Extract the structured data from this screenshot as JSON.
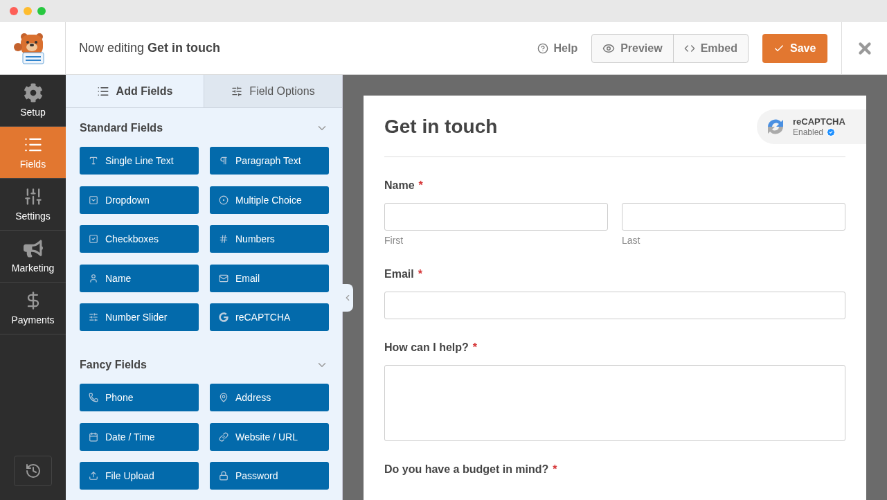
{
  "header": {
    "prefix": "Now editing",
    "form_name": "Get in touch",
    "help": "Help",
    "preview": "Preview",
    "embed": "Embed",
    "save": "Save"
  },
  "nav": [
    {
      "kind": "setup",
      "label": "Setup",
      "selected": false
    },
    {
      "kind": "fields",
      "label": "Fields",
      "selected": true
    },
    {
      "kind": "settings",
      "label": "Settings",
      "selected": false
    },
    {
      "kind": "marketing",
      "label": "Marketing",
      "selected": false
    },
    {
      "kind": "payments",
      "label": "Payments",
      "selected": false
    }
  ],
  "panel_tabs": [
    {
      "kind": "add",
      "label": "Add Fields",
      "selected": true
    },
    {
      "kind": "options",
      "label": "Field Options",
      "selected": false
    }
  ],
  "sections": [
    {
      "title": "Standard Fields",
      "expanded": true,
      "fields": [
        {
          "kind": "text",
          "label": "Single Line Text"
        },
        {
          "kind": "paragraph",
          "label": "Paragraph Text"
        },
        {
          "kind": "dropdown",
          "label": "Dropdown"
        },
        {
          "kind": "radio",
          "label": "Multiple Choice"
        },
        {
          "kind": "checkbox",
          "label": "Checkboxes"
        },
        {
          "kind": "number",
          "label": "Numbers"
        },
        {
          "kind": "name",
          "label": "Name"
        },
        {
          "kind": "email",
          "label": "Email"
        },
        {
          "kind": "slider",
          "label": "Number Slider"
        },
        {
          "kind": "captcha",
          "label": "reCAPTCHA"
        }
      ]
    },
    {
      "title": "Fancy Fields",
      "expanded": true,
      "fields": [
        {
          "kind": "phone",
          "label": "Phone"
        },
        {
          "kind": "address",
          "label": "Address"
        },
        {
          "kind": "date",
          "label": "Date / Time"
        },
        {
          "kind": "url",
          "label": "Website / URL"
        },
        {
          "kind": "upload",
          "label": "File Upload"
        },
        {
          "kind": "password",
          "label": "Password"
        }
      ]
    }
  ],
  "form": {
    "title": "Get in touch",
    "required_marker": "*",
    "recaptcha": {
      "name": "reCAPTCHA",
      "status": "Enabled"
    },
    "fields": [
      {
        "kind": "name",
        "label": "Name",
        "required": true,
        "sublabels": [
          "First",
          "Last"
        ]
      },
      {
        "kind": "email",
        "label": "Email",
        "required": true
      },
      {
        "kind": "textarea",
        "label": "How can I help?",
        "required": true
      },
      {
        "kind": "label_only",
        "label": "Do you have a budget in mind?",
        "required": true
      }
    ]
  }
}
